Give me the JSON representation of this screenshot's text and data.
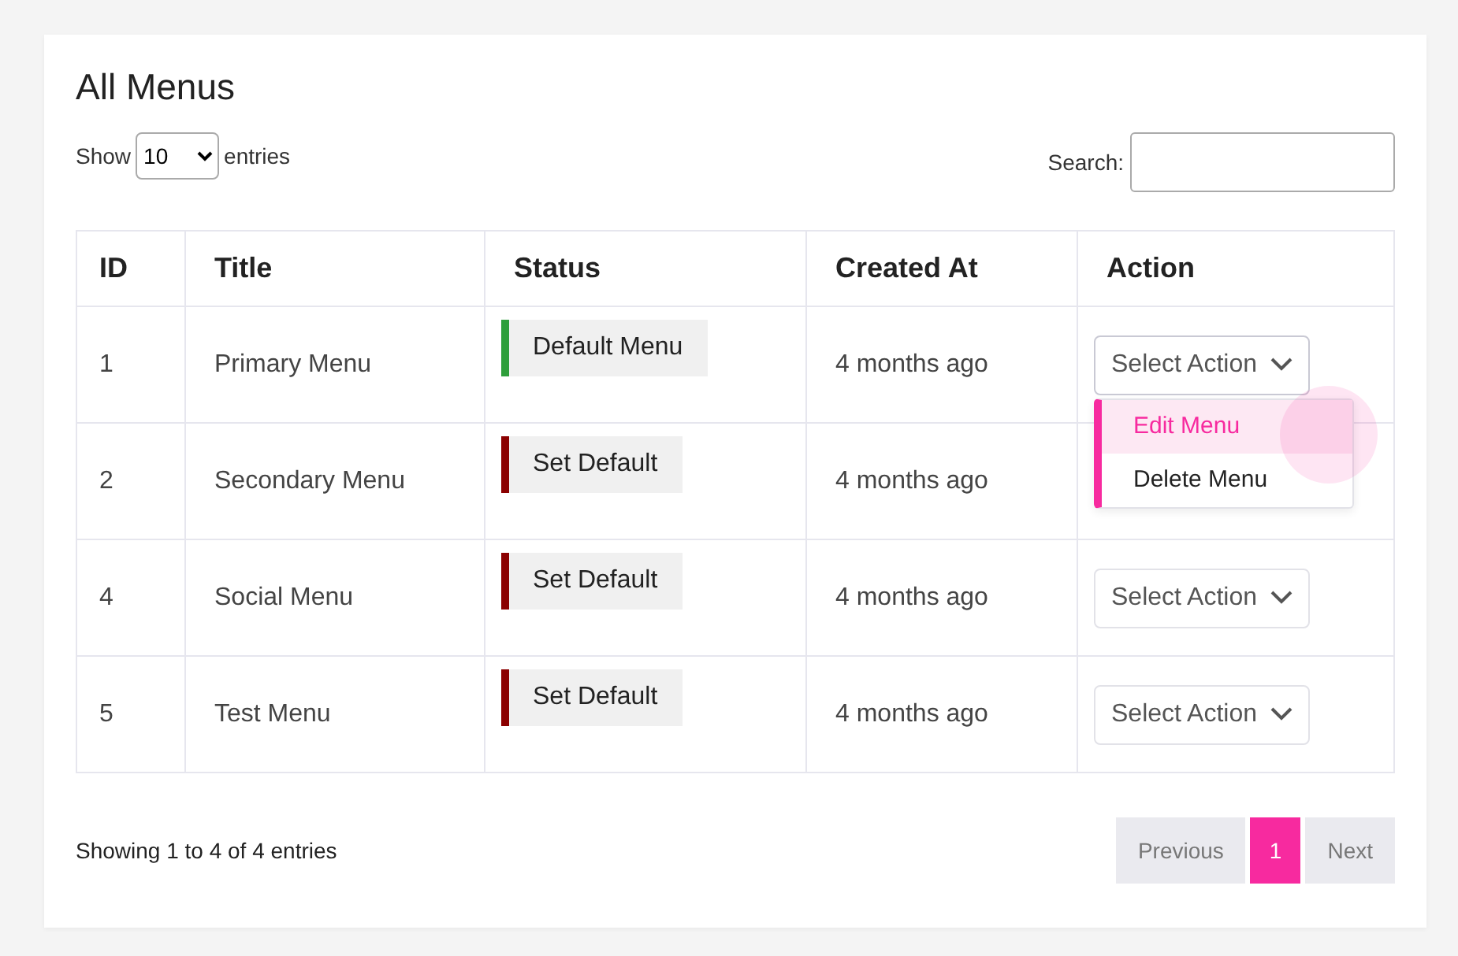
{
  "title": "All Menus",
  "length": {
    "show": "Show",
    "value": "10",
    "entries": "entries"
  },
  "search": {
    "label": "Search:"
  },
  "table": {
    "columns": [
      "ID",
      "Title",
      "Status",
      "Created At",
      "Action"
    ],
    "rows": [
      {
        "id": "1",
        "title": "Primary Menu",
        "status": {
          "label": "Default Menu",
          "color": "#2e9e3a"
        },
        "created": "4 months ago",
        "action": {
          "label": "Select Action",
          "expanded": true,
          "menu": [
            {
              "label": "Edit Menu",
              "selected": true
            },
            {
              "label": "Delete Menu",
              "selected": false
            }
          ]
        }
      },
      {
        "id": "2",
        "title": "Secondary Menu",
        "status": {
          "label": "Set Default",
          "color": "#8b0000"
        },
        "created": "4 months ago"
      },
      {
        "id": "4",
        "title": "Social Menu",
        "status": {
          "label": "Set Default",
          "color": "#8b0000"
        },
        "created": "4 months ago",
        "action": {
          "label": "Select Action",
          "expanded": false
        }
      },
      {
        "id": "5",
        "title": "Test Menu",
        "status": {
          "label": "Set Default",
          "color": "#8b0000"
        },
        "created": "4 months ago",
        "action": {
          "label": "Select Action",
          "expanded": false
        }
      }
    ]
  },
  "info": "Showing 1 to 4 of 4 entries",
  "pagination": [
    {
      "label": "Previous",
      "selected": false
    },
    {
      "label": "1",
      "selected": true
    },
    {
      "label": "Next",
      "selected": false
    }
  ]
}
